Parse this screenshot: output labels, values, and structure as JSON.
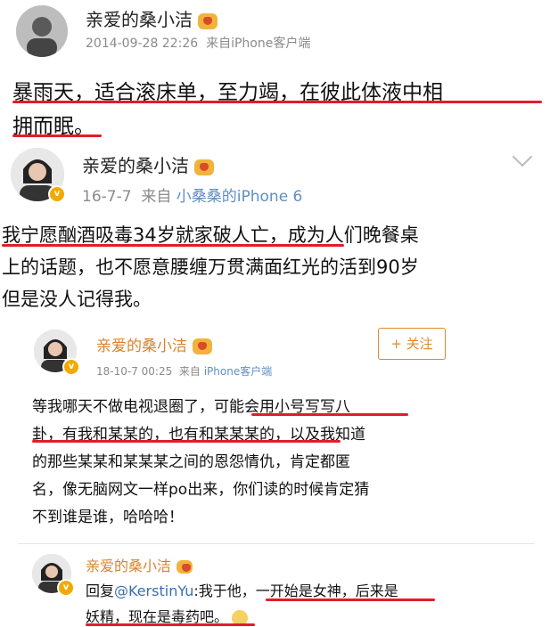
{
  "post1": {
    "username": "亲爱的桑小洁",
    "date": "2014-09-28 22:26",
    "source": "来自iPhone客户端",
    "lines": [
      "暴雨天，适合滚床单，至力竭，在彼此体液中相",
      "拥而眠。"
    ]
  },
  "post2": {
    "username": "亲爱的桑小洁",
    "date": "16-7-7",
    "source_prefix": "来自",
    "source_device": "小桑桑的iPhone 6",
    "lines": [
      "我宁愿酗酒吸毒34岁就家破人亡，成为人们晚餐桌",
      "上的话题，也不愿意腰缠万贯满面红光的活到90岁",
      "但是没人记得我。"
    ]
  },
  "post3": {
    "username": "亲爱的桑小洁",
    "date": "18-10-7 00:25",
    "source_prefix": "来自",
    "source_device": "iPhone客户端",
    "follow_label": "+ 关注",
    "lines": [
      "等我哪天不做电视退圈了，可能会用小号写写八",
      "卦，有我和某某的，也有和某某某的，以及我知道",
      "的那些某某和某某某之间的恩怨情仇，肯定都匿",
      "名，像无脑网文一样po出来，你们读的时候肯定猜",
      "不到谁是谁，哈哈哈！"
    ]
  },
  "post4": {
    "username": "亲爱的桑小洁",
    "reply_prefix": "回复",
    "reply_handle": "@KerstinYu",
    "line1_rest": ":我于他，一开始是女神，后来是",
    "line2": "妖精，现在是毒药吧。"
  },
  "colors": {
    "underline": "#e21c2b",
    "link": "#5f8fc4",
    "orange_name": "#d9822b",
    "badge": "#f2a900"
  }
}
